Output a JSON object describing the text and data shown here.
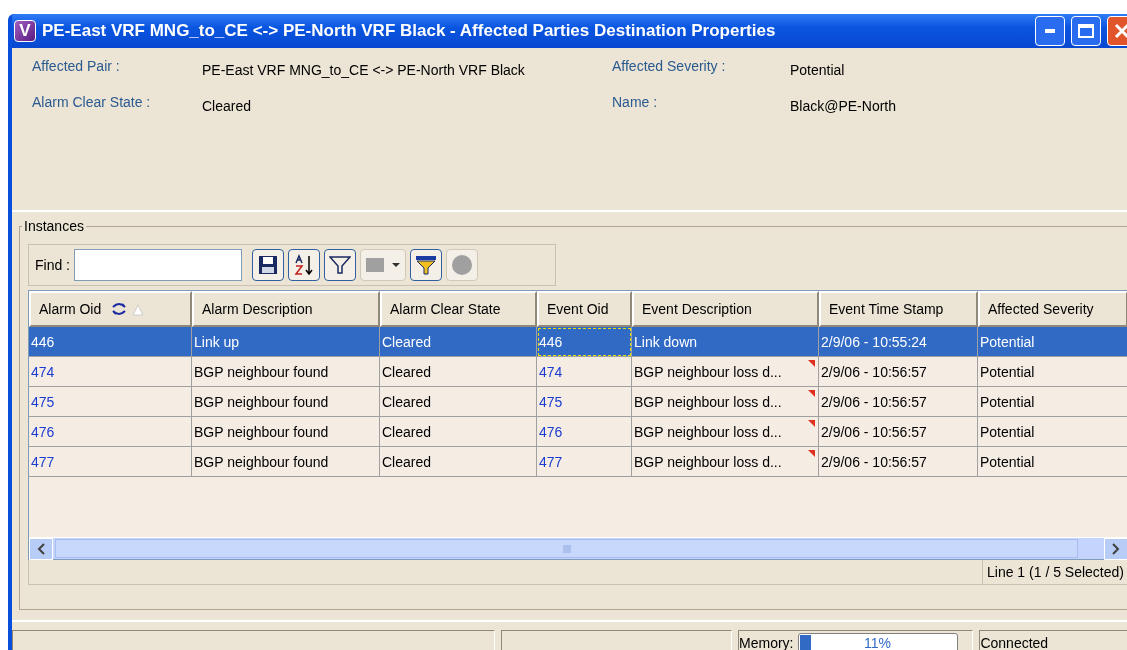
{
  "window": {
    "icon_letter": "V",
    "title": "PE-East VRF MNG_to_CE <-> PE-North VRF Black - Affected Parties Destination Properties"
  },
  "properties": [
    {
      "label": "Affected Pair :",
      "value": "PE-East VRF MNG_to_CE <-> PE-North VRF Black"
    },
    {
      "label": "Affected Severity :",
      "value": "Potential"
    },
    {
      "label": "Alarm Clear State :",
      "value": "Cleared"
    },
    {
      "label": "Name :",
      "value": "Black@PE-North"
    }
  ],
  "instances": {
    "title": "Instances",
    "find": {
      "label": "Find :"
    },
    "columns": [
      {
        "label": "Alarm Oid",
        "kind": "link",
        "sorted": true
      },
      {
        "label": "Alarm Description",
        "kind": "text",
        "sorted": false
      },
      {
        "label": "Alarm Clear State",
        "kind": "text",
        "sorted": false
      },
      {
        "label": "Event Oid",
        "kind": "link",
        "sorted": false
      },
      {
        "label": "Event Description",
        "kind": "text",
        "sorted": false
      },
      {
        "label": "Event Time Stamp",
        "kind": "text",
        "sorted": false
      },
      {
        "label": "Affected Severity",
        "kind": "text",
        "sorted": false
      }
    ],
    "rows": [
      {
        "selected": true,
        "focused": true,
        "marked": false,
        "cells": [
          "446",
          "Link up",
          "Cleared",
          "446",
          "Link down",
          "2/9/06 - 10:55:24",
          "Potential"
        ]
      },
      {
        "selected": false,
        "focused": false,
        "marked": true,
        "cells": [
          "474",
          "BGP neighbour found",
          "Cleared",
          "474",
          "BGP neighbour loss d...",
          "2/9/06 - 10:56:57",
          "Potential"
        ]
      },
      {
        "selected": false,
        "focused": false,
        "marked": true,
        "cells": [
          "475",
          "BGP neighbour found",
          "Cleared",
          "475",
          "BGP neighbour loss d...",
          "2/9/06 - 10:56:57",
          "Potential"
        ]
      },
      {
        "selected": false,
        "focused": false,
        "marked": true,
        "cells": [
          "476",
          "BGP neighbour found",
          "Cleared",
          "476",
          "BGP neighbour loss d...",
          "2/9/06 - 10:56:57",
          "Potential"
        ]
      },
      {
        "selected": false,
        "focused": false,
        "marked": true,
        "cells": [
          "477",
          "BGP neighbour found",
          "Cleared",
          "477",
          "BGP neighbour loss d...",
          "2/9/06 - 10:56:57",
          "Potential"
        ]
      }
    ],
    "line_status": "Line 1 (1 / 5 Selected)"
  },
  "status_bar": {
    "memory_label": "Memory:",
    "memory": {
      "level": 0.07,
      "reading": "11%"
    },
    "connection": "Connected"
  }
}
